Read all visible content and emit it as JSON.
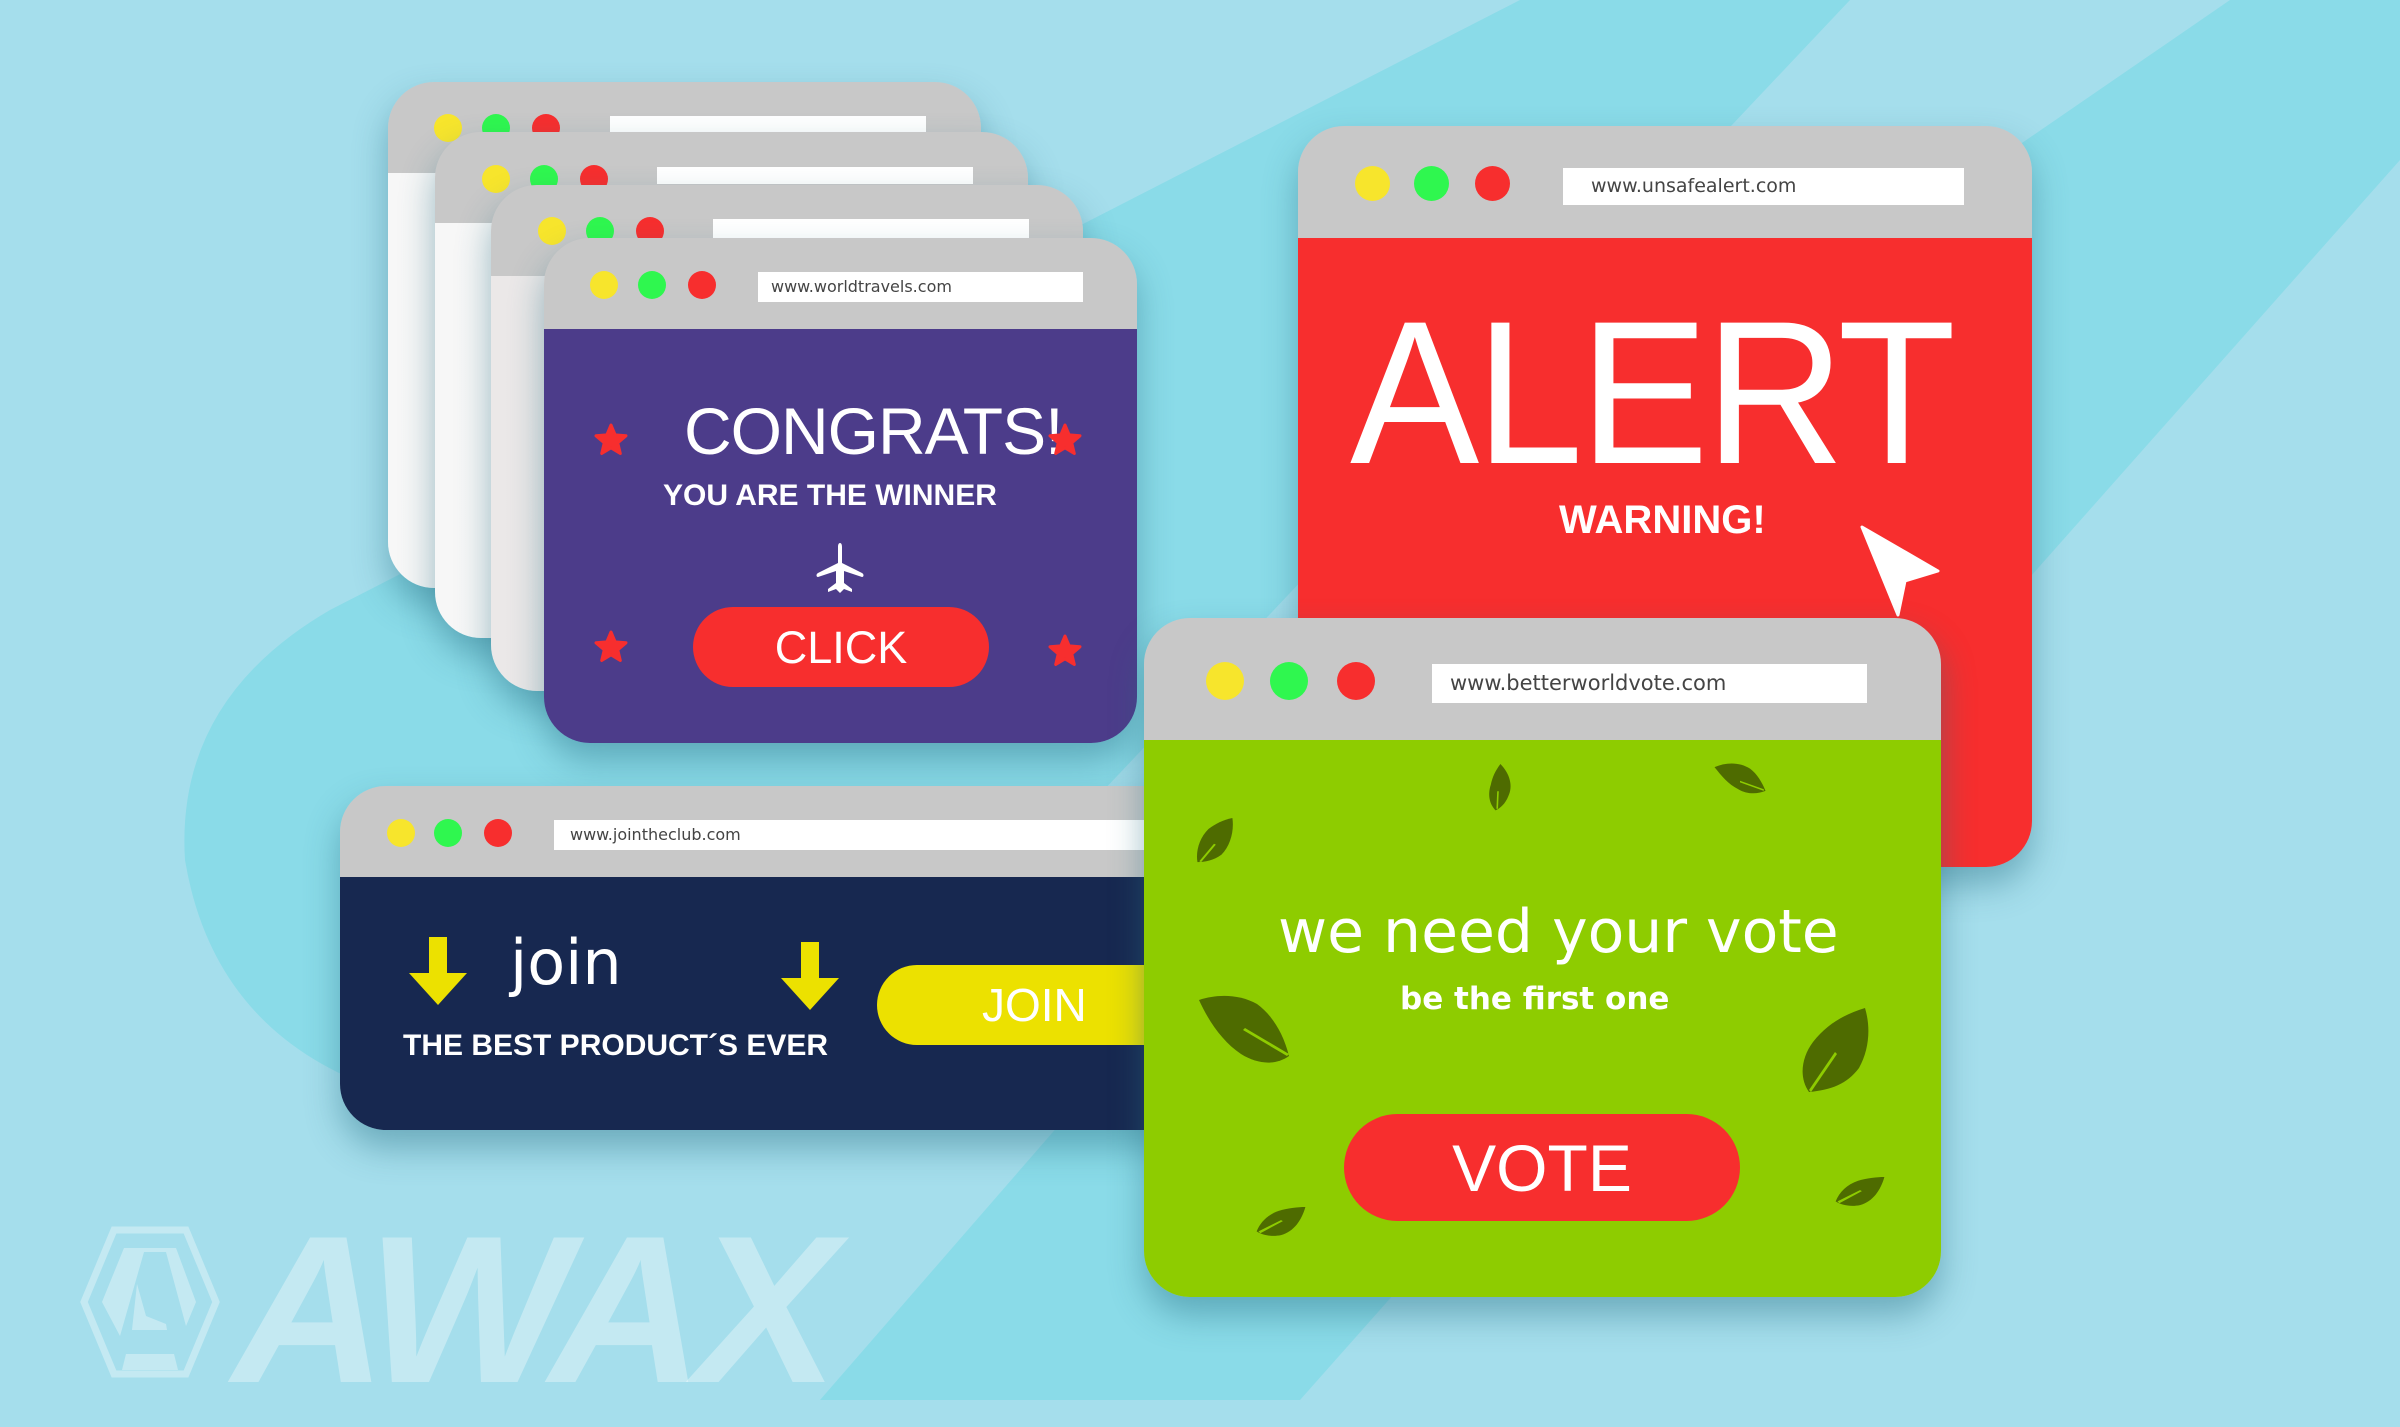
{
  "brand": {
    "name": "AWAX",
    "icon": "awax-hexagon-logo-icon"
  },
  "colors": {
    "background": "#a5deec",
    "background_band": "#8adbe8",
    "window_header": "#c8c8c8",
    "dot_yellow": "#f7e52c",
    "dot_green": "#2ff74f",
    "dot_red": "#f72e2e",
    "congrats_body": "#4c3c8a",
    "alert_body": "#f72e2e",
    "join_body": "#172850",
    "vote_body": "#8ecc00",
    "leaf": "#4e6b00",
    "red_button": "#f72e2e",
    "yellow_button": "#ece100"
  },
  "stacked_windows": [
    {
      "url": ""
    },
    {
      "url": ""
    },
    {
      "url": ""
    }
  ],
  "congrats_window": {
    "url": "www.worldtravels.com",
    "headline": "CONGRATS!",
    "subheadline": "YOU ARE THE WINNER",
    "icon": "airplane-icon",
    "button_label": "CLICK",
    "decor_icon": "star-icon"
  },
  "alert_window": {
    "url": "www.unsafealert.com",
    "headline": "ALERT",
    "subheadline": "WARNING!",
    "icon": "mouse-cursor-icon"
  },
  "join_window": {
    "url": "www.jointheclub.com",
    "headline": "join",
    "subheadline": "THE BEST PRODUCT´S EVER",
    "icon": "arrow-down-icon",
    "button_label": "JOIN"
  },
  "vote_window": {
    "url": "www.betterworldvote.com",
    "headline": "we need your vote",
    "subheadline": "be the first one",
    "decor_icon": "leaf-icon",
    "button_label": "VOTE"
  }
}
